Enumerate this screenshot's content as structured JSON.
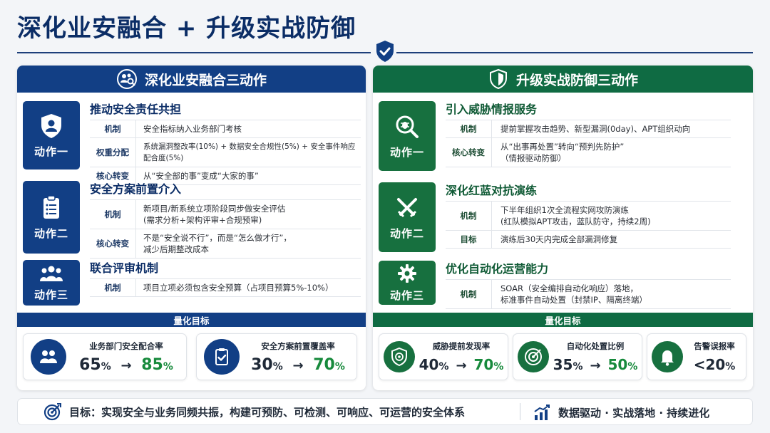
{
  "title": "深化业安融合 + 升级实战防御",
  "left_panel": {
    "header": "深化业安融合三动作",
    "actions": [
      {
        "badge": "动作一",
        "title": "推动安全责任共担",
        "rows": [
          {
            "key": "机制",
            "value": "安全指标纳入业务部门考核"
          },
          {
            "key": "权重分配",
            "value": "系统漏洞整改率(10%) + 数据安全合规性(5%) + 安全事件响应配合度(5%)"
          },
          {
            "key": "核心转变",
            "value": "从“安全部的事”变成“大家的事”"
          }
        ]
      },
      {
        "badge": "动作二",
        "title": "安全方案前置介入",
        "rows": [
          {
            "key": "机制",
            "value": "新项目/新系统立项阶段同步做安全评估",
            "value2": "(需求分析+架构评审+合规预审)"
          },
          {
            "key": "核心转变",
            "value": "不是“安全说不行”，而是“怎么做才行”，",
            "value2": "减少后期整改成本"
          }
        ]
      },
      {
        "badge": "动作三",
        "title": "联合评审机制",
        "rows": [
          {
            "key": "机制",
            "value": "项目立项必须包含安全预算（占项目预算5%-10%）"
          }
        ]
      }
    ],
    "metrics_title": "量化目标",
    "metrics": [
      {
        "label": "业务部门安全配合率",
        "from": "65",
        "to": "85",
        "unit": "%",
        "arrow": "→"
      },
      {
        "label": "安全方案前置覆盖率",
        "from": "30",
        "to": "70",
        "unit": "%",
        "arrow": "→"
      }
    ]
  },
  "right_panel": {
    "header": "升级实战防御三动作",
    "actions": [
      {
        "badge": "动作一",
        "title": "引入威胁情报服务",
        "rows": [
          {
            "key": "机制",
            "value": "提前掌握攻击趋势、新型漏洞(0day)、APT组织动向"
          },
          {
            "key": "核心转变",
            "value": "从“出事再处置”转向“预判先防护”",
            "value2": "（情报驱动防御）"
          }
        ]
      },
      {
        "badge": "动作二",
        "title": "深化红蓝对抗演练",
        "rows": [
          {
            "key": "机制",
            "value": "下半年组织1次全流程实网攻防演练",
            "value2": "(红队模拟APT攻击，蓝队防守，持续2周)"
          },
          {
            "key": "目标",
            "value": "演练后30天内完成全部漏洞修复"
          }
        ]
      },
      {
        "badge": "动作三",
        "title": "优化自动化运营能力",
        "rows": [
          {
            "key": "机制",
            "value": "SOAR（安全编排自动化响应）落地，",
            "value2": "标准事件自动处置（封禁IP、隔离终端）"
          }
        ]
      }
    ],
    "metrics_title": "量化目标",
    "metrics": [
      {
        "label": "威胁提前发现率",
        "from": "40",
        "to": "70",
        "unit": "%",
        "arrow": "→"
      },
      {
        "label": "自动化处置比例",
        "from": "35",
        "to": "50",
        "unit": "%",
        "arrow": "→"
      },
      {
        "label": "告警误报率",
        "value": "<20",
        "unit": "%"
      }
    ]
  },
  "footer": {
    "goal": "目标：实现安全与业务同频共振，构建可预防、可检测、可响应、可运营的安全体系",
    "motto": "数据驱动 · 实战落地 · 持续进化"
  },
  "colors": {
    "navy": "#123f85",
    "green": "#17703f",
    "accent_green": "#178a3c",
    "title": "#0b2d66"
  }
}
